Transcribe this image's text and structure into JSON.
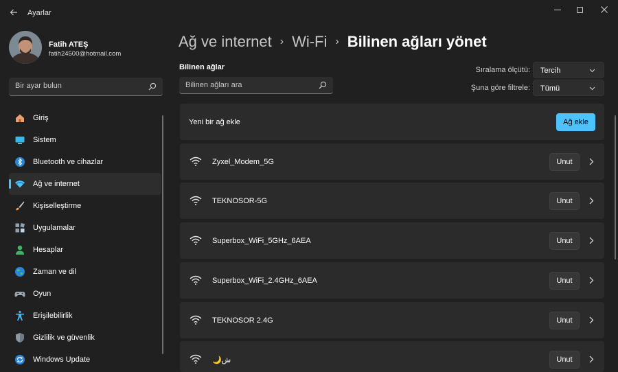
{
  "window": {
    "title": "Ayarlar"
  },
  "profile": {
    "name": "Fatih ATEŞ",
    "email": "fatih24500@hotmail.com"
  },
  "sidebar": {
    "search_placeholder": "Bir ayar bulun",
    "items": [
      {
        "label": "Giriş",
        "icon": "home-icon"
      },
      {
        "label": "Sistem",
        "icon": "system-icon"
      },
      {
        "label": "Bluetooth ve cihazlar",
        "icon": "bluetooth-icon"
      },
      {
        "label": "Ağ ve internet",
        "icon": "network-icon",
        "active": true
      },
      {
        "label": "Kişiselleştirme",
        "icon": "brush-icon"
      },
      {
        "label": "Uygulamalar",
        "icon": "apps-icon"
      },
      {
        "label": "Hesaplar",
        "icon": "account-icon"
      },
      {
        "label": "Zaman ve dil",
        "icon": "globe-icon"
      },
      {
        "label": "Oyun",
        "icon": "gamepad-icon"
      },
      {
        "label": "Erişilebilirlik",
        "icon": "accessibility-icon"
      },
      {
        "label": "Gizlilik ve güvenlik",
        "icon": "shield-icon"
      },
      {
        "label": "Windows Update",
        "icon": "update-icon"
      }
    ]
  },
  "breadcrumb": {
    "parts": [
      "Ağ ve internet",
      "Wi-Fi"
    ],
    "current": "Bilinen ağları yönet",
    "separator": "›"
  },
  "known_networks": {
    "section_label": "Bilinen ağlar",
    "search_placeholder": "Bilinen ağları ara",
    "sort_label": "Sıralama ölçütü:",
    "sort_value": "Tercih",
    "filter_label": "Şuna göre filtrele:",
    "filter_value": "Tümü",
    "add_label": "Yeni bir ağ ekle",
    "add_button": "Ağ ekle",
    "forget_label": "Unut",
    "networks": [
      {
        "name": "Zyxel_Modem_5G"
      },
      {
        "name": "TEKNOSOR-5G"
      },
      {
        "name": "Superbox_WiFi_5GHz_6AEA"
      },
      {
        "name": "Superbox_WiFi_2.4GHz_6AEA"
      },
      {
        "name": "TEKNOSOR 2.4G"
      },
      {
        "name": "🌙ش"
      }
    ]
  },
  "colors": {
    "accent": "#4cc2ff",
    "background": "#202020",
    "card": "#2b2b2b"
  }
}
